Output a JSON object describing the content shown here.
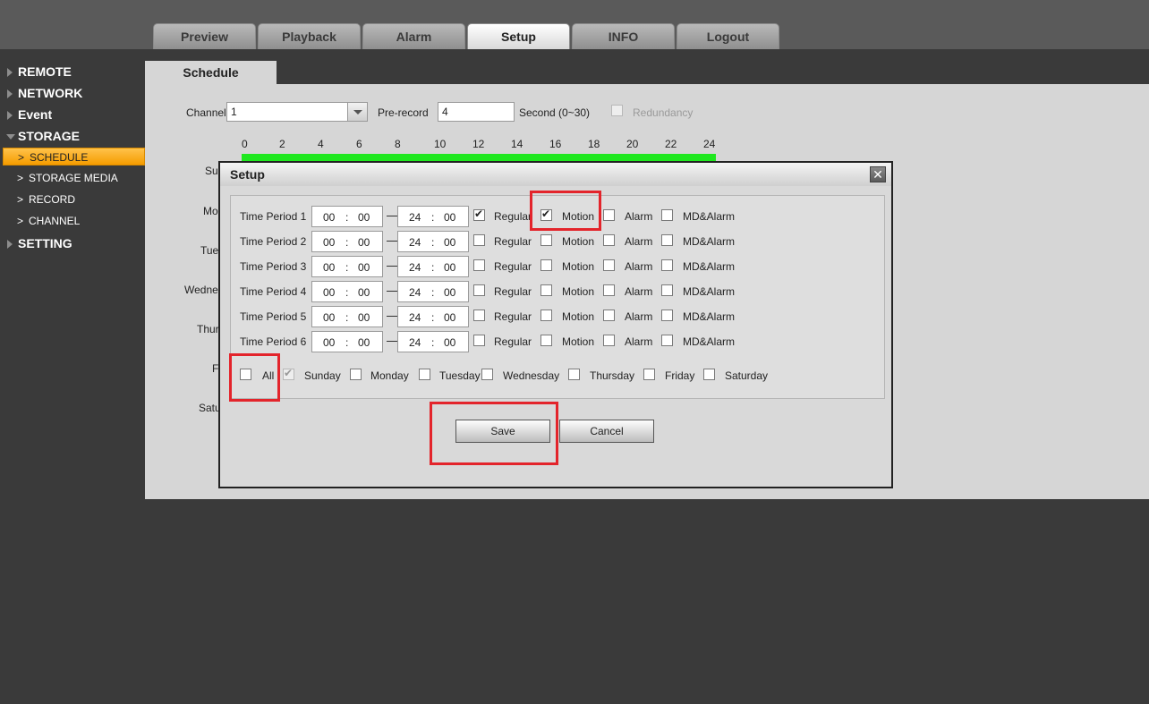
{
  "top_tabs": [
    {
      "label": "Preview"
    },
    {
      "label": "Playback"
    },
    {
      "label": "Alarm"
    },
    {
      "label": "Setup",
      "active": true
    },
    {
      "label": "INFO"
    },
    {
      "label": "Logout"
    }
  ],
  "sidebar": {
    "items": [
      {
        "label": "REMOTE"
      },
      {
        "label": "NETWORK"
      },
      {
        "label": "Event"
      },
      {
        "label": "STORAGE",
        "expanded": true
      },
      {
        "label": "SETTING"
      }
    ],
    "storage_subitems": [
      {
        "label": "SCHEDULE",
        "active": true
      },
      {
        "label": "STORAGE MEDIA"
      },
      {
        "label": "RECORD"
      },
      {
        "label": "CHANNEL"
      }
    ]
  },
  "main": {
    "tab_label": "Schedule",
    "channel_label": "Channel",
    "channel_value": "1",
    "prerecord_label": "Pre-record",
    "prerecord_value": "4",
    "second_label": "Second (0~30)",
    "redundancy_label": "Redundancy",
    "hour_ticks": [
      "0",
      "2",
      "4",
      "6",
      "8",
      "10",
      "12",
      "14",
      "16",
      "18",
      "20",
      "22",
      "24"
    ],
    "day_labels_partial": [
      "Su",
      "Mo",
      "Tue",
      "Wedne",
      "Thur",
      "F",
      "Satu"
    ]
  },
  "modal": {
    "title": "Setup",
    "close_glyph": "✕",
    "time_periods": [
      {
        "label": "Time Period 1",
        "start_h": "00",
        "start_m": "00",
        "end_h": "24",
        "end_m": "00",
        "regular": true,
        "motion": true,
        "alarm": false,
        "md_alarm": false
      },
      {
        "label": "Time Period 2",
        "start_h": "00",
        "start_m": "00",
        "end_h": "24",
        "end_m": "00",
        "regular": false,
        "motion": false,
        "alarm": false,
        "md_alarm": false
      },
      {
        "label": "Time Period 3",
        "start_h": "00",
        "start_m": "00",
        "end_h": "24",
        "end_m": "00",
        "regular": false,
        "motion": false,
        "alarm": false,
        "md_alarm": false
      },
      {
        "label": "Time Period 4",
        "start_h": "00",
        "start_m": "00",
        "end_h": "24",
        "end_m": "00",
        "regular": false,
        "motion": false,
        "alarm": false,
        "md_alarm": false
      },
      {
        "label": "Time Period 5",
        "start_h": "00",
        "start_m": "00",
        "end_h": "24",
        "end_m": "00",
        "regular": false,
        "motion": false,
        "alarm": false,
        "md_alarm": false
      },
      {
        "label": "Time Period 6",
        "start_h": "00",
        "start_m": "00",
        "end_h": "24",
        "end_m": "00",
        "regular": false,
        "motion": false,
        "alarm": false,
        "md_alarm": false
      }
    ],
    "option_labels": {
      "regular": "Regular",
      "motion": "Motion",
      "alarm": "Alarm",
      "md_alarm": "MD&Alarm"
    },
    "time_separator": ":",
    "days": [
      {
        "label": "All",
        "checked": false
      },
      {
        "label": "Sunday",
        "checked": true,
        "disabled": true
      },
      {
        "label": "Monday",
        "checked": false
      },
      {
        "label": "Tuesday",
        "checked": false
      },
      {
        "label": "Wednesday",
        "checked": false
      },
      {
        "label": "Thursday",
        "checked": false
      },
      {
        "label": "Friday",
        "checked": false
      },
      {
        "label": "Saturday",
        "checked": false
      }
    ],
    "save_label": "Save",
    "cancel_label": "Cancel"
  },
  "colors": {
    "accent_orange": "#f59c00",
    "schedule_green": "#1fe81f",
    "highlight_red": "#e3242b"
  }
}
